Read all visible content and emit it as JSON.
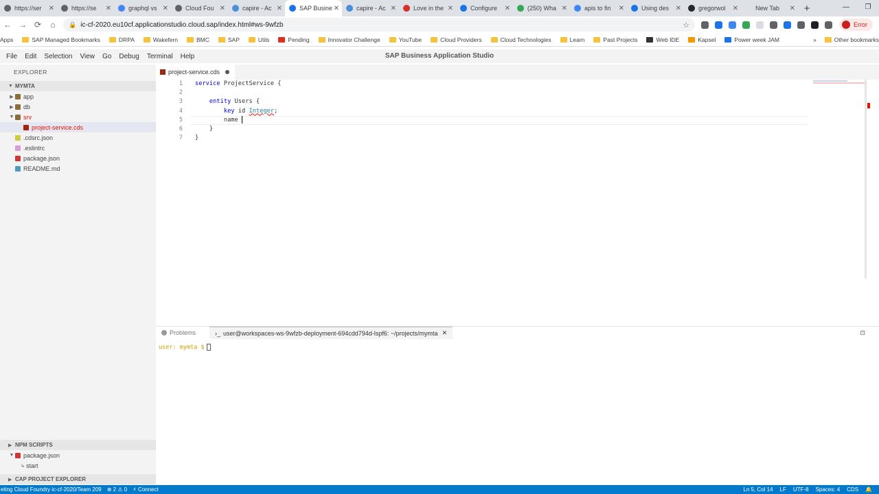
{
  "browser": {
    "tabs": [
      {
        "title": "https://ser",
        "color": "#5f6368"
      },
      {
        "title": "https://se",
        "color": "#5f6368"
      },
      {
        "title": "graphql vs",
        "color": "#4285f4"
      },
      {
        "title": "Cloud Fou",
        "color": "#5f6368"
      },
      {
        "title": "capire - Ac",
        "color": "#4a90d9"
      },
      {
        "title": "SAP Busine",
        "color": "#1a73e8",
        "active": true
      },
      {
        "title": "capire - Ac",
        "color": "#4a90d9"
      },
      {
        "title": "Love in the",
        "color": "#d93025"
      },
      {
        "title": "Configure",
        "color": "#1a73e8"
      },
      {
        "title": "(250) Wha",
        "color": "#34a853"
      },
      {
        "title": "apis to fin",
        "color": "#4285f4"
      },
      {
        "title": "Using des",
        "color": "#1a73e8"
      },
      {
        "title": "gregorwol",
        "color": "#24292e"
      },
      {
        "title": "New Tab",
        "color": "#dee1e6"
      }
    ],
    "new_tab_symbol": "+",
    "window_controls": [
      "—",
      "❐"
    ],
    "url": "ic-cf-2020.eu10cf.applicationstudio.cloud.sap/index.html#ws-9wfzb",
    "profile_status": "Error",
    "extension_colors": [
      "#5f6368",
      "#1a73e8",
      "#4285f4",
      "#34a853",
      "#dadce0",
      "#5f6368",
      "#1a73e8",
      "#5f6368",
      "#202124",
      "#5f6368"
    ],
    "bookmarks": [
      {
        "label": "Apps",
        "kind": "apps"
      },
      {
        "label": "SAP Managed Bookmarks",
        "kind": "folder"
      },
      {
        "label": "DRPA",
        "kind": "folder"
      },
      {
        "label": "Wakefern",
        "kind": "folder"
      },
      {
        "label": "BMC",
        "kind": "folder"
      },
      {
        "label": "SAP",
        "kind": "folder"
      },
      {
        "label": "Utils",
        "kind": "folder"
      },
      {
        "label": "Pending",
        "kind": "red"
      },
      {
        "label": "Innovator Challenge",
        "kind": "folder"
      },
      {
        "label": "YouTube",
        "kind": "folder"
      },
      {
        "label": "Cloud Providers",
        "kind": "folder"
      },
      {
        "label": "Cloud Technologies",
        "kind": "folder"
      },
      {
        "label": "Learn",
        "kind": "folder"
      },
      {
        "label": "Past Projects",
        "kind": "folder"
      },
      {
        "label": "Web IDE",
        "kind": "dark"
      },
      {
        "label": "Kapsel",
        "kind": "orange"
      },
      {
        "label": "Power week JAM",
        "kind": "blue"
      }
    ],
    "overflow_symbol": "»",
    "other_bookmarks": "Other bookmarks"
  },
  "ide": {
    "title": "SAP Business Application Studio",
    "menu": [
      "File",
      "Edit",
      "Selection",
      "View",
      "Go",
      "Debug",
      "Terminal",
      "Help"
    ],
    "explorer_title": "EXPLORER",
    "project_name": "MYMTA",
    "tree": [
      {
        "label": "app",
        "type": "folder",
        "indent": 0
      },
      {
        "label": "db",
        "type": "folder",
        "indent": 0
      },
      {
        "label": "srv",
        "type": "folder-open",
        "indent": 0,
        "color": "#e51400"
      },
      {
        "label": "project-service.cds",
        "type": "file",
        "indent": 1,
        "color": "#e51400",
        "icon": "#a1260d",
        "selected": true
      },
      {
        "label": ".cdsrc.json",
        "type": "file",
        "indent": 0,
        "icon": "#cbcb41"
      },
      {
        "label": ".eslintrc",
        "type": "file",
        "indent": 0,
        "icon": "#d6a0d6"
      },
      {
        "label": "package.json",
        "type": "file",
        "indent": 0,
        "icon": "#cb3837"
      },
      {
        "label": "README.md",
        "type": "file",
        "indent": 0,
        "icon": "#519aba"
      }
    ],
    "npm_scripts_title": "NPM SCRIPTS",
    "npm_package": "package.json",
    "npm_script": "start",
    "cap_explorer_title": "CAP PROJECT EXPLORER",
    "editor_tab": "project-service.cds",
    "line_numbers": [
      "1",
      "2",
      "3",
      "4",
      "5",
      "6",
      "7"
    ],
    "code": {
      "l1_kw": "service",
      "l1_rest": " ProjectService {",
      "l3_indent": "    ",
      "l3_kw": "entity",
      "l3_rest": " Users {",
      "l4_indent": "        ",
      "l4_kw": "key",
      "l4_mid": " id ",
      "l4_type": "Integer",
      "l4_end": ";",
      "l5_indent": "        ",
      "l5_text": "name ",
      "l6_text": "    }",
      "l7_text": "}"
    },
    "panel": {
      "problems": "Problems",
      "terminal_tab": "user@workspaces-ws-9wfzb-deployment-694cdd794d-lspf6: ~/projects/mymta",
      "close_symbol": "✕",
      "maximize_symbol": "⊡",
      "prompt": "user: mymta $"
    },
    "status": {
      "left": "eting Cloud Foundry ic-cf-2020/Team 209",
      "problems": "⊗ 2 ⚠ 0",
      "connect": "Connect",
      "position": "Ln 5, Col 14",
      "eol": "LF",
      "encoding": "UTF-8",
      "spaces": "Spaces: 4",
      "language": "CDS",
      "bell": "🔔"
    }
  }
}
